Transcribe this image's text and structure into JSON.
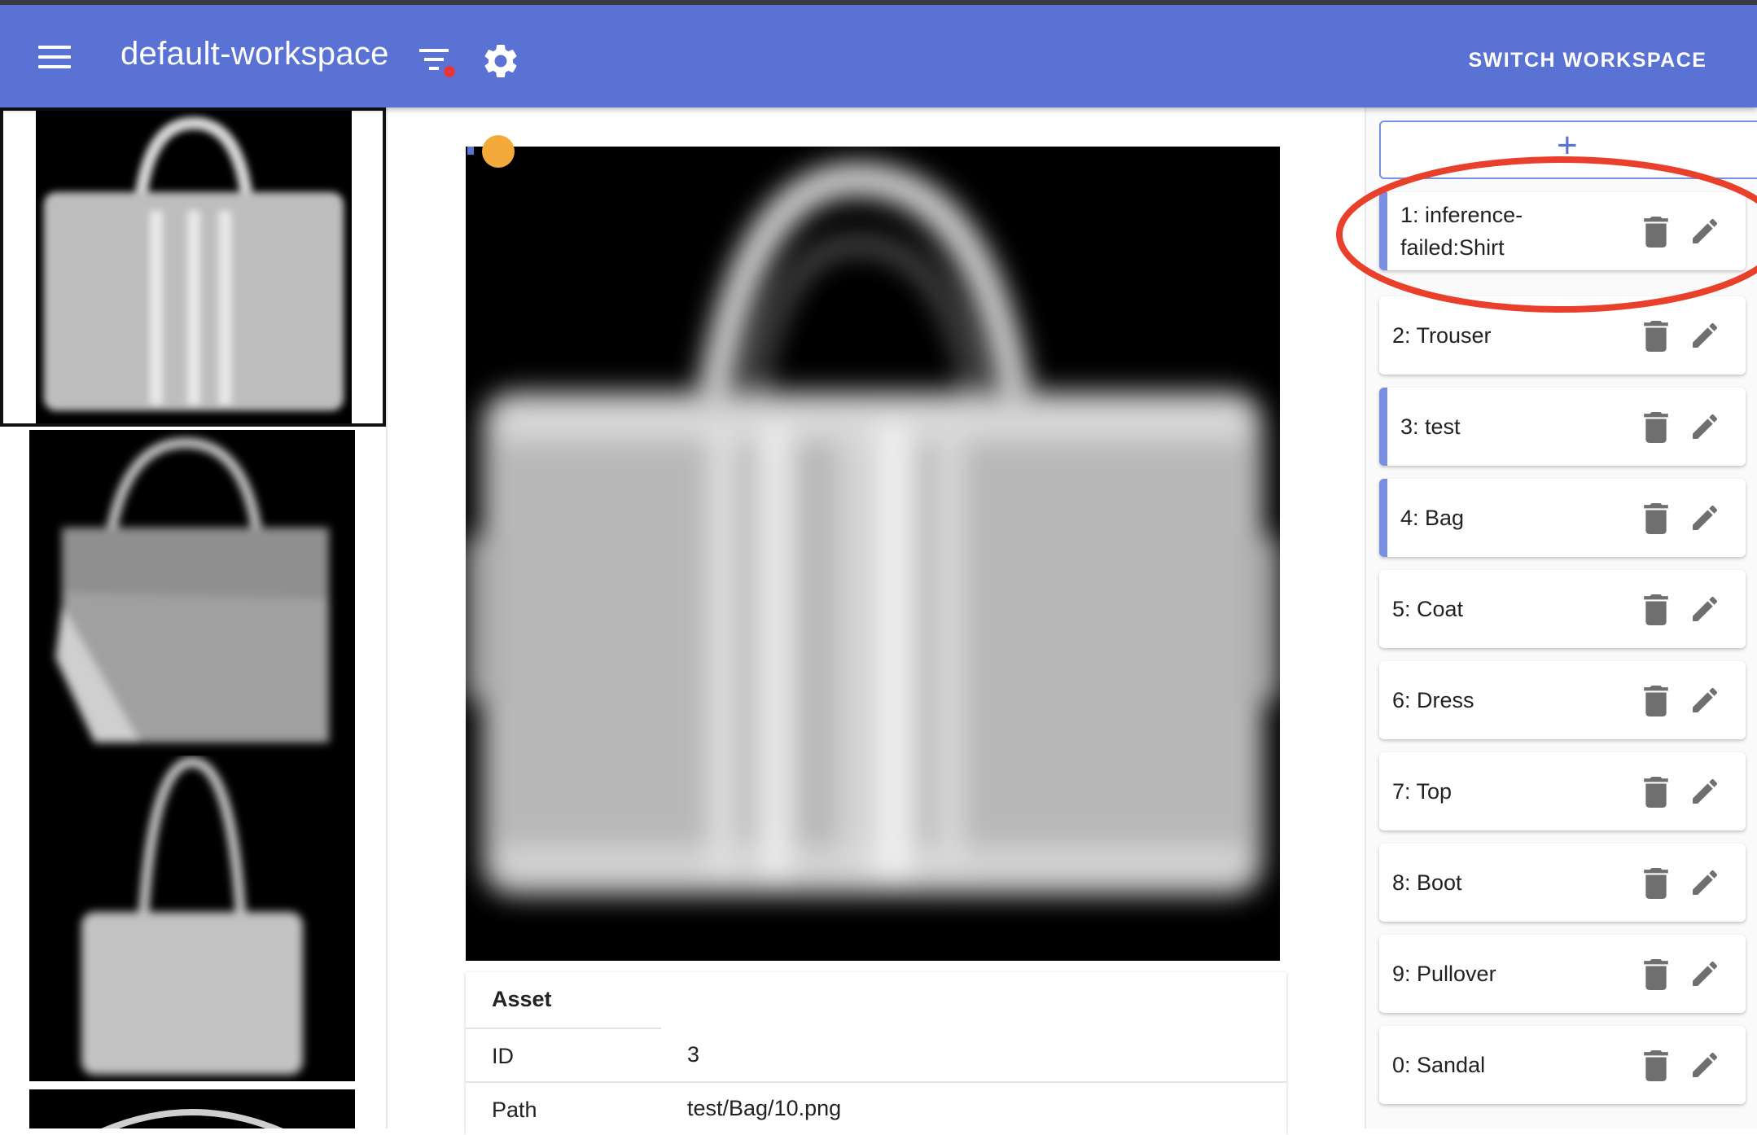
{
  "appbar": {
    "workspace_title": "default-workspace",
    "switch_label": "SWITCH WORKSPACE",
    "icons": [
      "menu-icon",
      "filter-icon",
      "gear-icon"
    ],
    "filter_badge_color": "#e5353d",
    "bar_color": "#5a72d3"
  },
  "asset": {
    "heading": "Asset",
    "rows": [
      {
        "key": "ID",
        "value": "3"
      },
      {
        "key": "Path",
        "value": "test/Bag/10.png"
      }
    ]
  },
  "classes": {
    "add_label": "+",
    "items": [
      {
        "label": "1: inference-failed:Shirt",
        "active": true
      },
      {
        "label": "2: Trouser",
        "active": false
      },
      {
        "label": "3: test",
        "active": true
      },
      {
        "label": "4: Bag",
        "active": true
      },
      {
        "label": "5: Coat",
        "active": false
      },
      {
        "label": "6: Dress",
        "active": false
      },
      {
        "label": "7: Top",
        "active": false
      },
      {
        "label": "8: Boot",
        "active": false
      },
      {
        "label": "9: Pullover",
        "active": false
      },
      {
        "label": "0: Sandal",
        "active": false
      }
    ]
  },
  "annotation_color": "#e8402a"
}
